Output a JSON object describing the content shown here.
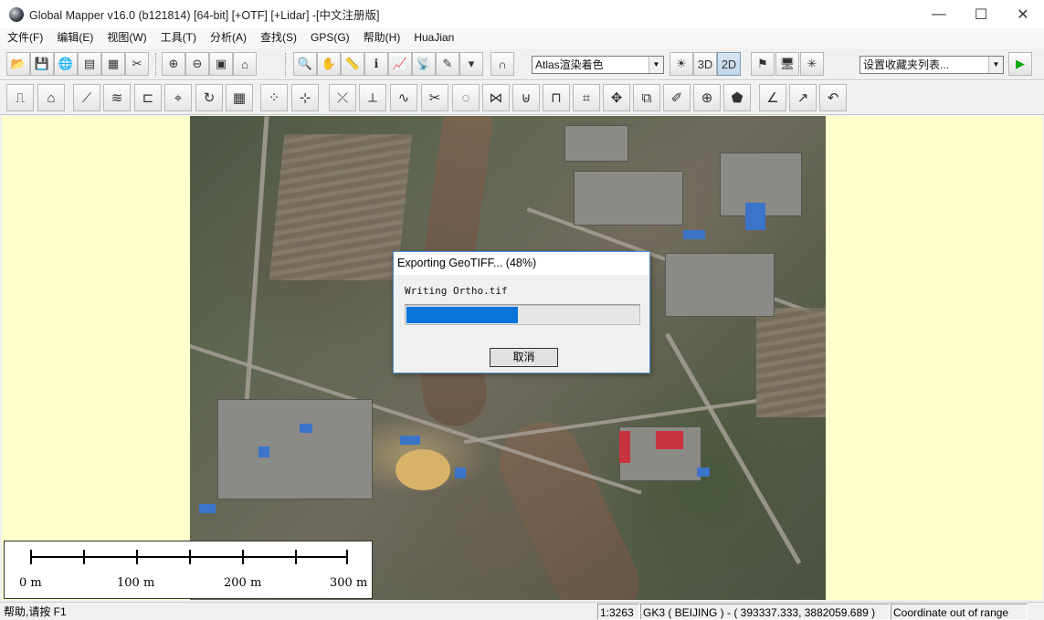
{
  "window": {
    "title": "Global Mapper v16.0 (b121814) [64-bit] [+OTF] [+Lidar] -[中文注册版]",
    "minimize": "—",
    "maximize": "☐",
    "close": "✕"
  },
  "menu": [
    "文件(F)",
    "编辑(E)",
    "视图(W)",
    "工具(T)",
    "分析(A)",
    "查找(S)",
    "GPS(G)",
    "帮助(H)",
    "HuaJian"
  ],
  "toolbar": {
    "shader_select": "Atlas渲染着色",
    "favorites_select": "设置收藏夹列表..."
  },
  "dialog": {
    "title": "Exporting GeoTIFF... (48%)",
    "message": "Writing Ortho.tif",
    "progress": 0.48,
    "cancel_label": "取消"
  },
  "scalebar": {
    "labels": [
      "0 m",
      "100 m",
      "200 m",
      "300 m"
    ]
  },
  "status": {
    "help": "帮助,请按 F1",
    "scale": "1:3263",
    "projection": "GK3 ( BEIJING ) - ( 393337.333, 3882059.689 )",
    "message": "Coordinate out of range"
  },
  "colors": {
    "map_background": "#ffffcc",
    "progress_fill": "#0a74da",
    "dialog_border": "#4a90d9"
  }
}
